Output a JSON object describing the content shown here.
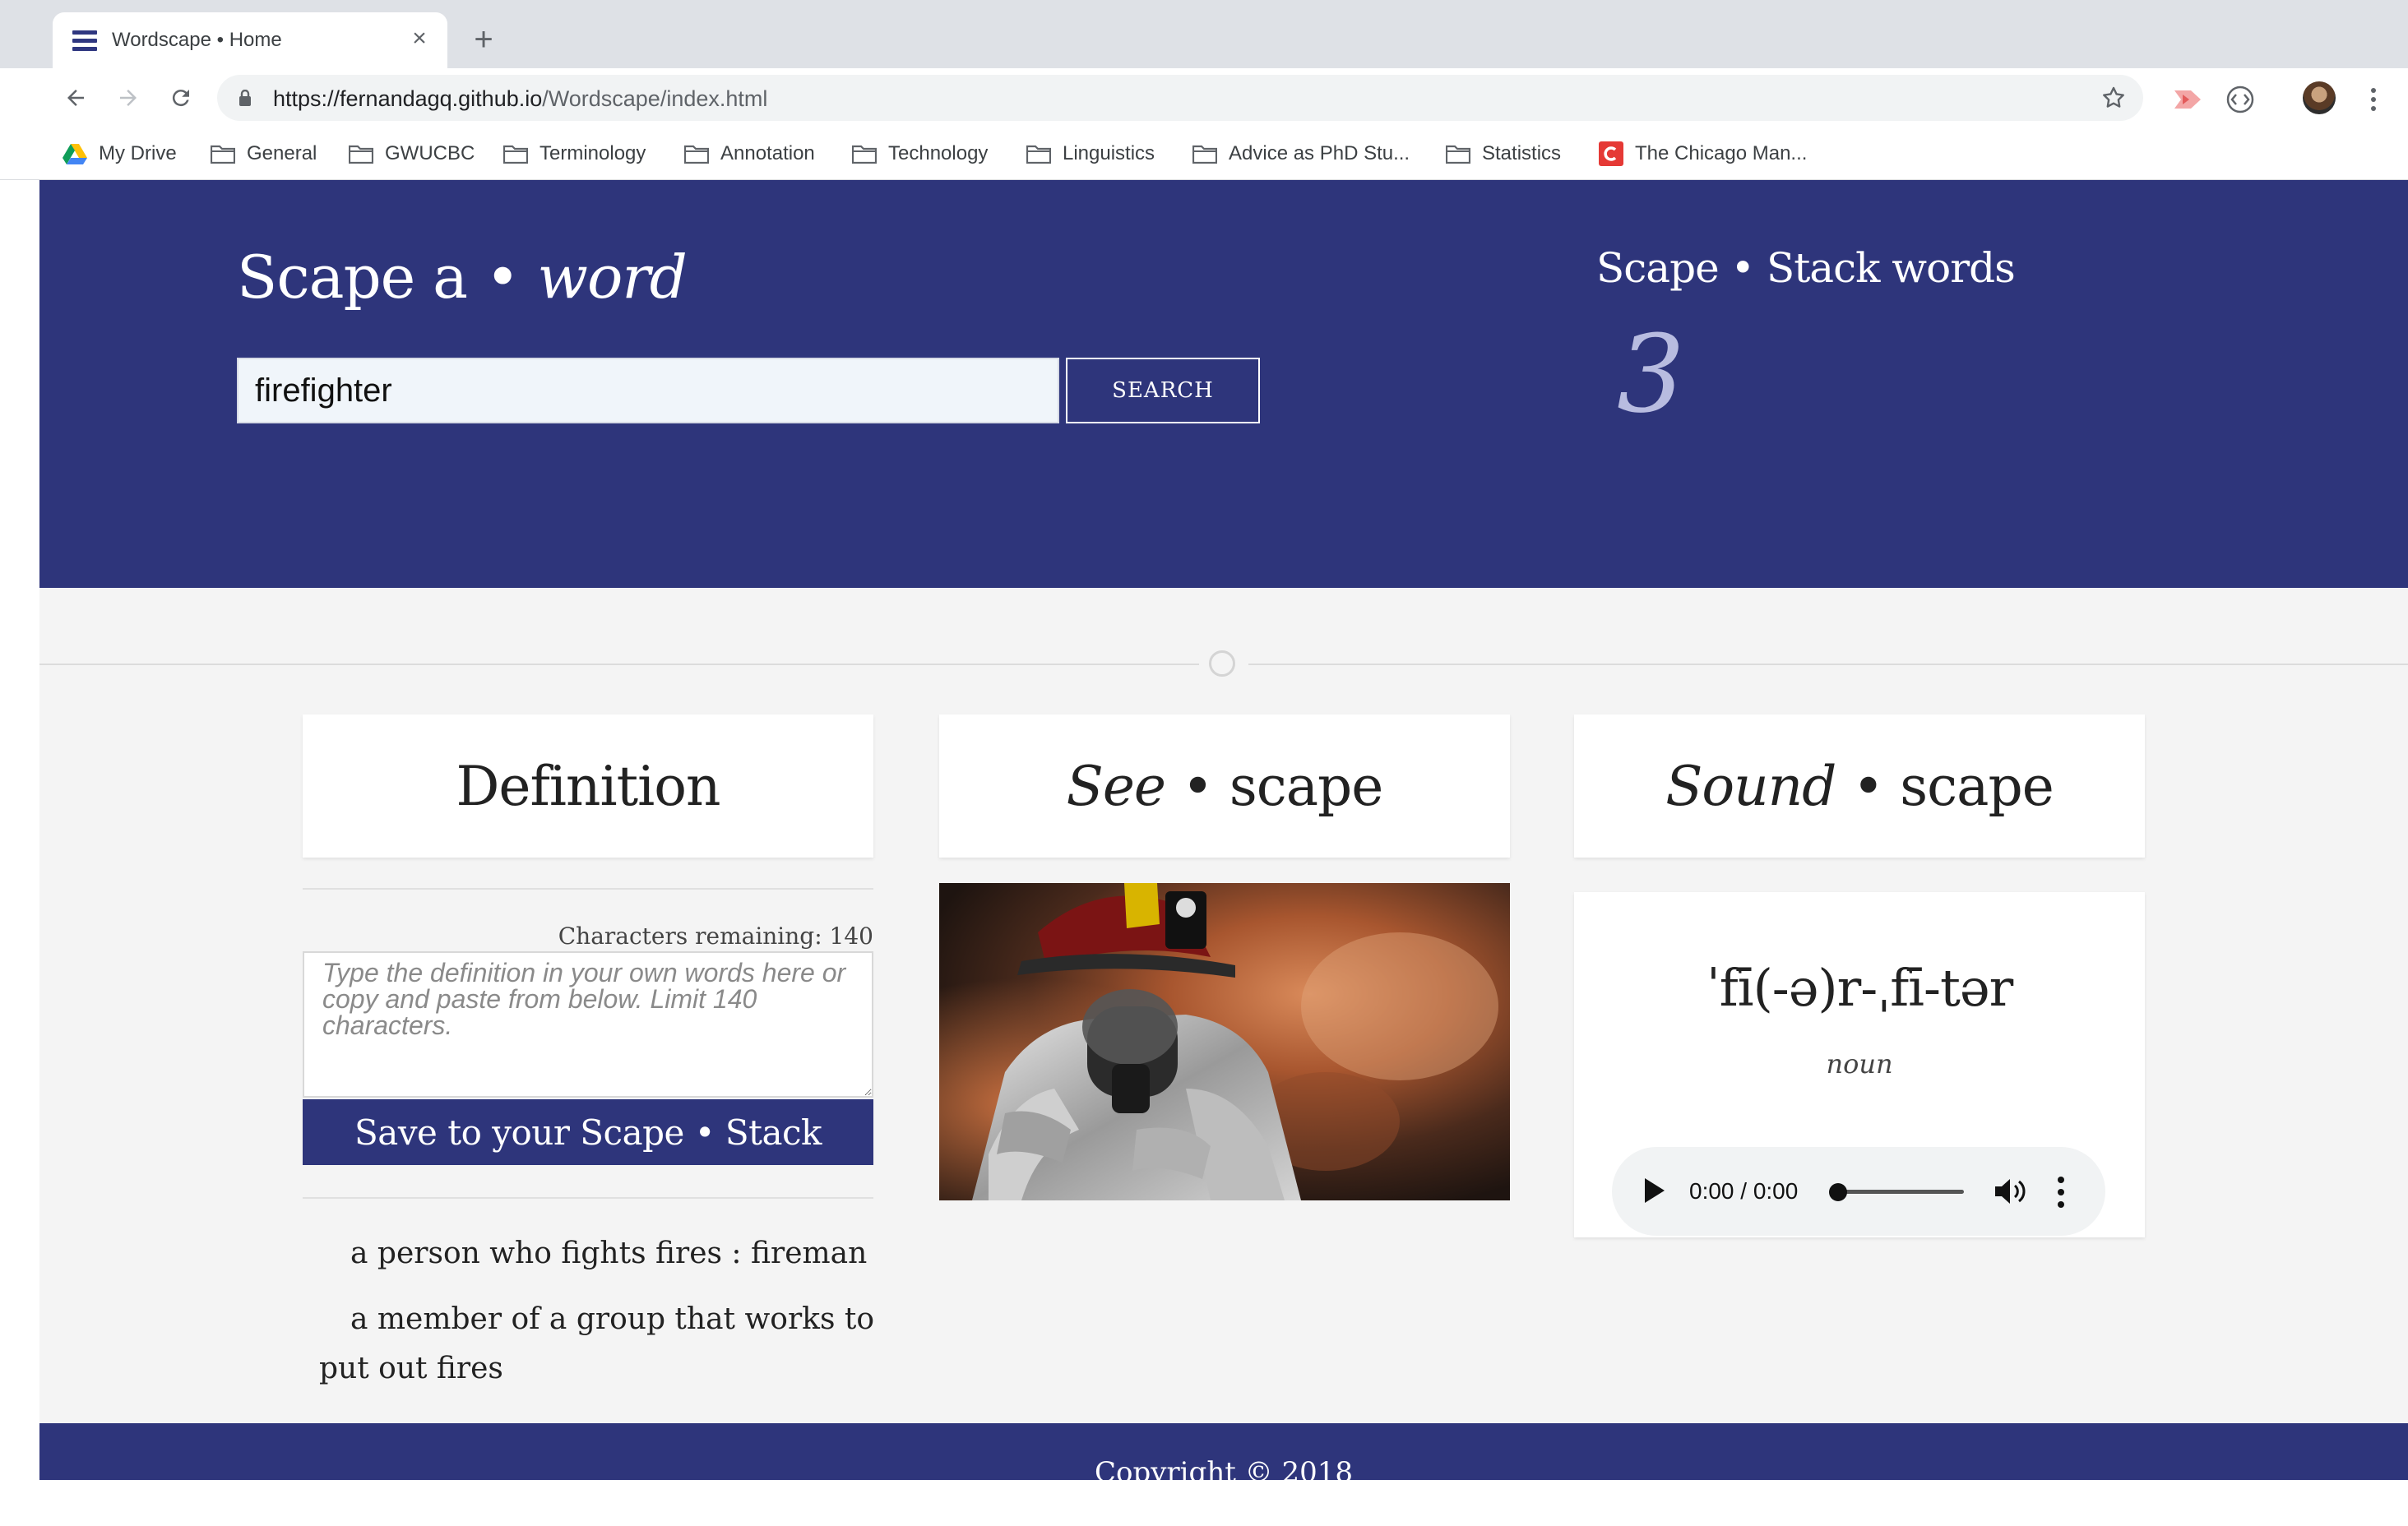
{
  "browser": {
    "tab_title": "Wordscape • Home",
    "url_host": "https://fernandagq.github.io",
    "url_path": "/Wordscape/index.html",
    "bookmarks": [
      {
        "label": "My Drive",
        "icon": "google-drive-icon"
      },
      {
        "label": "General",
        "icon": "folder-icon"
      },
      {
        "label": "GWUCBC",
        "icon": "folder-icon"
      },
      {
        "label": "Terminology",
        "icon": "folder-icon"
      },
      {
        "label": "Annotation",
        "icon": "folder-icon"
      },
      {
        "label": "Technology",
        "icon": "folder-icon"
      },
      {
        "label": "Linguistics",
        "icon": "folder-icon"
      },
      {
        "label": "Advice as PhD Stu...",
        "icon": "folder-icon"
      },
      {
        "label": "Statistics",
        "icon": "folder-icon"
      },
      {
        "label": "The Chicago Man...",
        "icon": "chicago-manual-icon"
      }
    ]
  },
  "hero": {
    "title_main": "Scape a",
    "title_word": "word",
    "search_value": "firefighter",
    "search_button": "SEARCH",
    "stack_title": "Scape • Stack words",
    "stack_count": "3"
  },
  "definition": {
    "heading": "Definition",
    "chars_remaining": "Characters remaining: 140",
    "textarea_placeholder": "Type the definition in your own words here or copy and paste from below. Limit 140 characters.",
    "save_button": "Save to your Scape • Stack",
    "entries": [
      "a person who fights fires : fireman",
      "a member of a group that works to put out fires"
    ]
  },
  "see": {
    "heading_em": "See",
    "heading_rest": "scape"
  },
  "sound": {
    "heading_em": "Sound",
    "heading_rest": "scape",
    "pronunciation": "ˈfī(-ə)r-ˌfī-tər",
    "part_of_speech": "noun",
    "audio_time": "0:00 / 0:00"
  },
  "footer": {
    "copyright": "Copyright © 2018"
  },
  "colors": {
    "brand": "#2e357b",
    "page_bg": "#f4f4f4",
    "stack_count": "#b8bce0"
  }
}
